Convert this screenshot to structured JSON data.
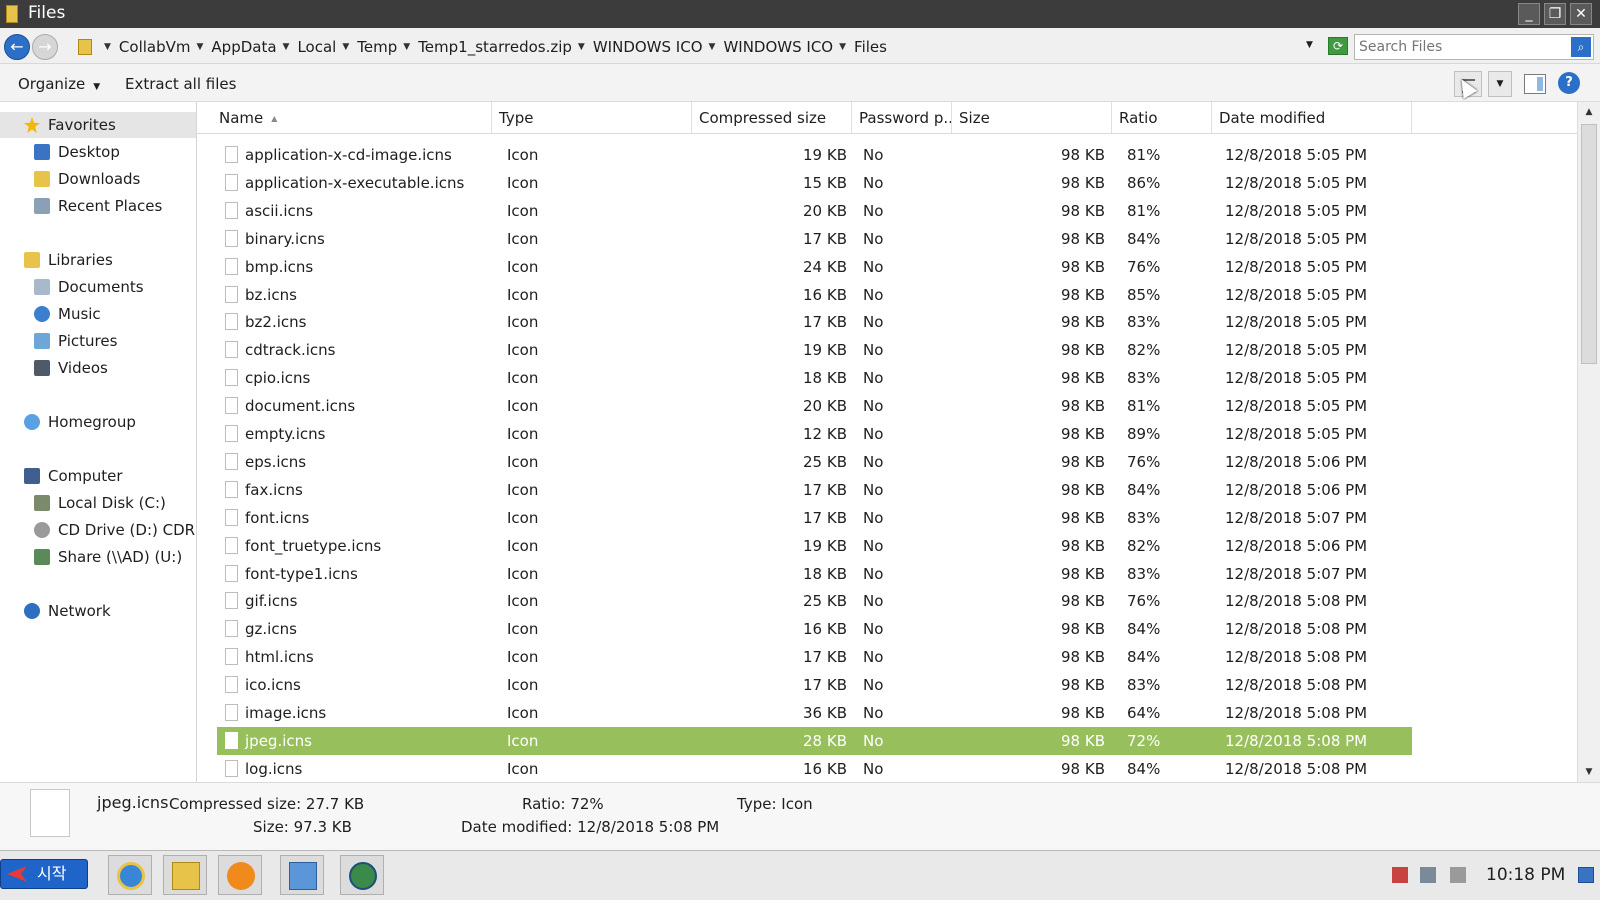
{
  "window": {
    "title": "Files"
  },
  "addressbar": {
    "crumbs": [
      "CollabVm",
      "AppData",
      "Local",
      "Temp",
      "Temp1_starredos.zip",
      "WINDOWS ICO",
      "WINDOWS ICO",
      "Files"
    ],
    "search_placeholder": "Search Files"
  },
  "commandbar": {
    "organize": "Organize",
    "extract": "Extract all files"
  },
  "sidebar": {
    "favorites": "Favorites",
    "desktop": "Desktop",
    "downloads": "Downloads",
    "recent": "Recent Places",
    "libraries": "Libraries",
    "documents": "Documents",
    "music": "Music",
    "pictures": "Pictures",
    "videos": "Videos",
    "homegroup": "Homegroup",
    "computer": "Computer",
    "local_disk": "Local Disk (C:)",
    "cd_drive": "CD Drive (D:) CDROM",
    "share": "Share (\\\\AD) (U:)",
    "network": "Network"
  },
  "columns": {
    "name": "Name",
    "type": "Type",
    "compressed": "Compressed size",
    "password": "Password p...",
    "size": "Size",
    "ratio": "Ratio",
    "date": "Date modified"
  },
  "files": [
    {
      "name": "application-x-cd-image.icns",
      "type": "Icon",
      "compressed": "19 KB",
      "password": "No",
      "size": "98 KB",
      "ratio": "81%",
      "date": "12/8/2018 5:05 PM"
    },
    {
      "name": "application-x-executable.icns",
      "type": "Icon",
      "compressed": "15 KB",
      "password": "No",
      "size": "98 KB",
      "ratio": "86%",
      "date": "12/8/2018 5:05 PM"
    },
    {
      "name": "ascii.icns",
      "type": "Icon",
      "compressed": "20 KB",
      "password": "No",
      "size": "98 KB",
      "ratio": "81%",
      "date": "12/8/2018 5:05 PM"
    },
    {
      "name": "binary.icns",
      "type": "Icon",
      "compressed": "17 KB",
      "password": "No",
      "size": "98 KB",
      "ratio": "84%",
      "date": "12/8/2018 5:05 PM"
    },
    {
      "name": "bmp.icns",
      "type": "Icon",
      "compressed": "24 KB",
      "password": "No",
      "size": "98 KB",
      "ratio": "76%",
      "date": "12/8/2018 5:05 PM"
    },
    {
      "name": "bz.icns",
      "type": "Icon",
      "compressed": "16 KB",
      "password": "No",
      "size": "98 KB",
      "ratio": "85%",
      "date": "12/8/2018 5:05 PM"
    },
    {
      "name": "bz2.icns",
      "type": "Icon",
      "compressed": "17 KB",
      "password": "No",
      "size": "98 KB",
      "ratio": "83%",
      "date": "12/8/2018 5:05 PM"
    },
    {
      "name": "cdtrack.icns",
      "type": "Icon",
      "compressed": "19 KB",
      "password": "No",
      "size": "98 KB",
      "ratio": "82%",
      "date": "12/8/2018 5:05 PM"
    },
    {
      "name": "cpio.icns",
      "type": "Icon",
      "compressed": "18 KB",
      "password": "No",
      "size": "98 KB",
      "ratio": "83%",
      "date": "12/8/2018 5:05 PM"
    },
    {
      "name": "document.icns",
      "type": "Icon",
      "compressed": "20 KB",
      "password": "No",
      "size": "98 KB",
      "ratio": "81%",
      "date": "12/8/2018 5:05 PM"
    },
    {
      "name": "empty.icns",
      "type": "Icon",
      "compressed": "12 KB",
      "password": "No",
      "size": "98 KB",
      "ratio": "89%",
      "date": "12/8/2018 5:05 PM"
    },
    {
      "name": "eps.icns",
      "type": "Icon",
      "compressed": "25 KB",
      "password": "No",
      "size": "98 KB",
      "ratio": "76%",
      "date": "12/8/2018 5:06 PM"
    },
    {
      "name": "fax.icns",
      "type": "Icon",
      "compressed": "17 KB",
      "password": "No",
      "size": "98 KB",
      "ratio": "84%",
      "date": "12/8/2018 5:06 PM"
    },
    {
      "name": "font.icns",
      "type": "Icon",
      "compressed": "17 KB",
      "password": "No",
      "size": "98 KB",
      "ratio": "83%",
      "date": "12/8/2018 5:07 PM"
    },
    {
      "name": "font_truetype.icns",
      "type": "Icon",
      "compressed": "19 KB",
      "password": "No",
      "size": "98 KB",
      "ratio": "82%",
      "date": "12/8/2018 5:06 PM"
    },
    {
      "name": "font-type1.icns",
      "type": "Icon",
      "compressed": "18 KB",
      "password": "No",
      "size": "98 KB",
      "ratio": "83%",
      "date": "12/8/2018 5:07 PM"
    },
    {
      "name": "gif.icns",
      "type": "Icon",
      "compressed": "25 KB",
      "password": "No",
      "size": "98 KB",
      "ratio": "76%",
      "date": "12/8/2018 5:08 PM"
    },
    {
      "name": "gz.icns",
      "type": "Icon",
      "compressed": "16 KB",
      "password": "No",
      "size": "98 KB",
      "ratio": "84%",
      "date": "12/8/2018 5:08 PM"
    },
    {
      "name": "html.icns",
      "type": "Icon",
      "compressed": "17 KB",
      "password": "No",
      "size": "98 KB",
      "ratio": "84%",
      "date": "12/8/2018 5:08 PM"
    },
    {
      "name": "ico.icns",
      "type": "Icon",
      "compressed": "17 KB",
      "password": "No",
      "size": "98 KB",
      "ratio": "83%",
      "date": "12/8/2018 5:08 PM"
    },
    {
      "name": "image.icns",
      "type": "Icon",
      "compressed": "36 KB",
      "password": "No",
      "size": "98 KB",
      "ratio": "64%",
      "date": "12/8/2018 5:08 PM"
    },
    {
      "name": "jpeg.icns",
      "type": "Icon",
      "compressed": "28 KB",
      "password": "No",
      "size": "98 KB",
      "ratio": "72%",
      "date": "12/8/2018 5:08 PM",
      "selected": true
    },
    {
      "name": "log.icns",
      "type": "Icon",
      "compressed": "16 KB",
      "password": "No",
      "size": "98 KB",
      "ratio": "84%",
      "date": "12/8/2018 5:08 PM"
    }
  ],
  "details": {
    "name": "jpeg.icns",
    "compressed": "Compressed size: 27.7 KB",
    "size": "Size: 97.3 KB",
    "ratio": "Ratio: 72%",
    "date": "Date modified: 12/8/2018 5:08 PM",
    "type": "Type: Icon"
  },
  "taskbar": {
    "start_label": "시작",
    "clock": "10:18 PM",
    "apps": [
      "internet-explorer-icon",
      "file-explorer-icon",
      "media-player-icon",
      "remote-desktop-icon",
      "network-globe-icon"
    ]
  },
  "colors": {
    "selection": "#97bf5c",
    "accent": "#2b6fc9",
    "titlebar": "#3c3c3c"
  }
}
